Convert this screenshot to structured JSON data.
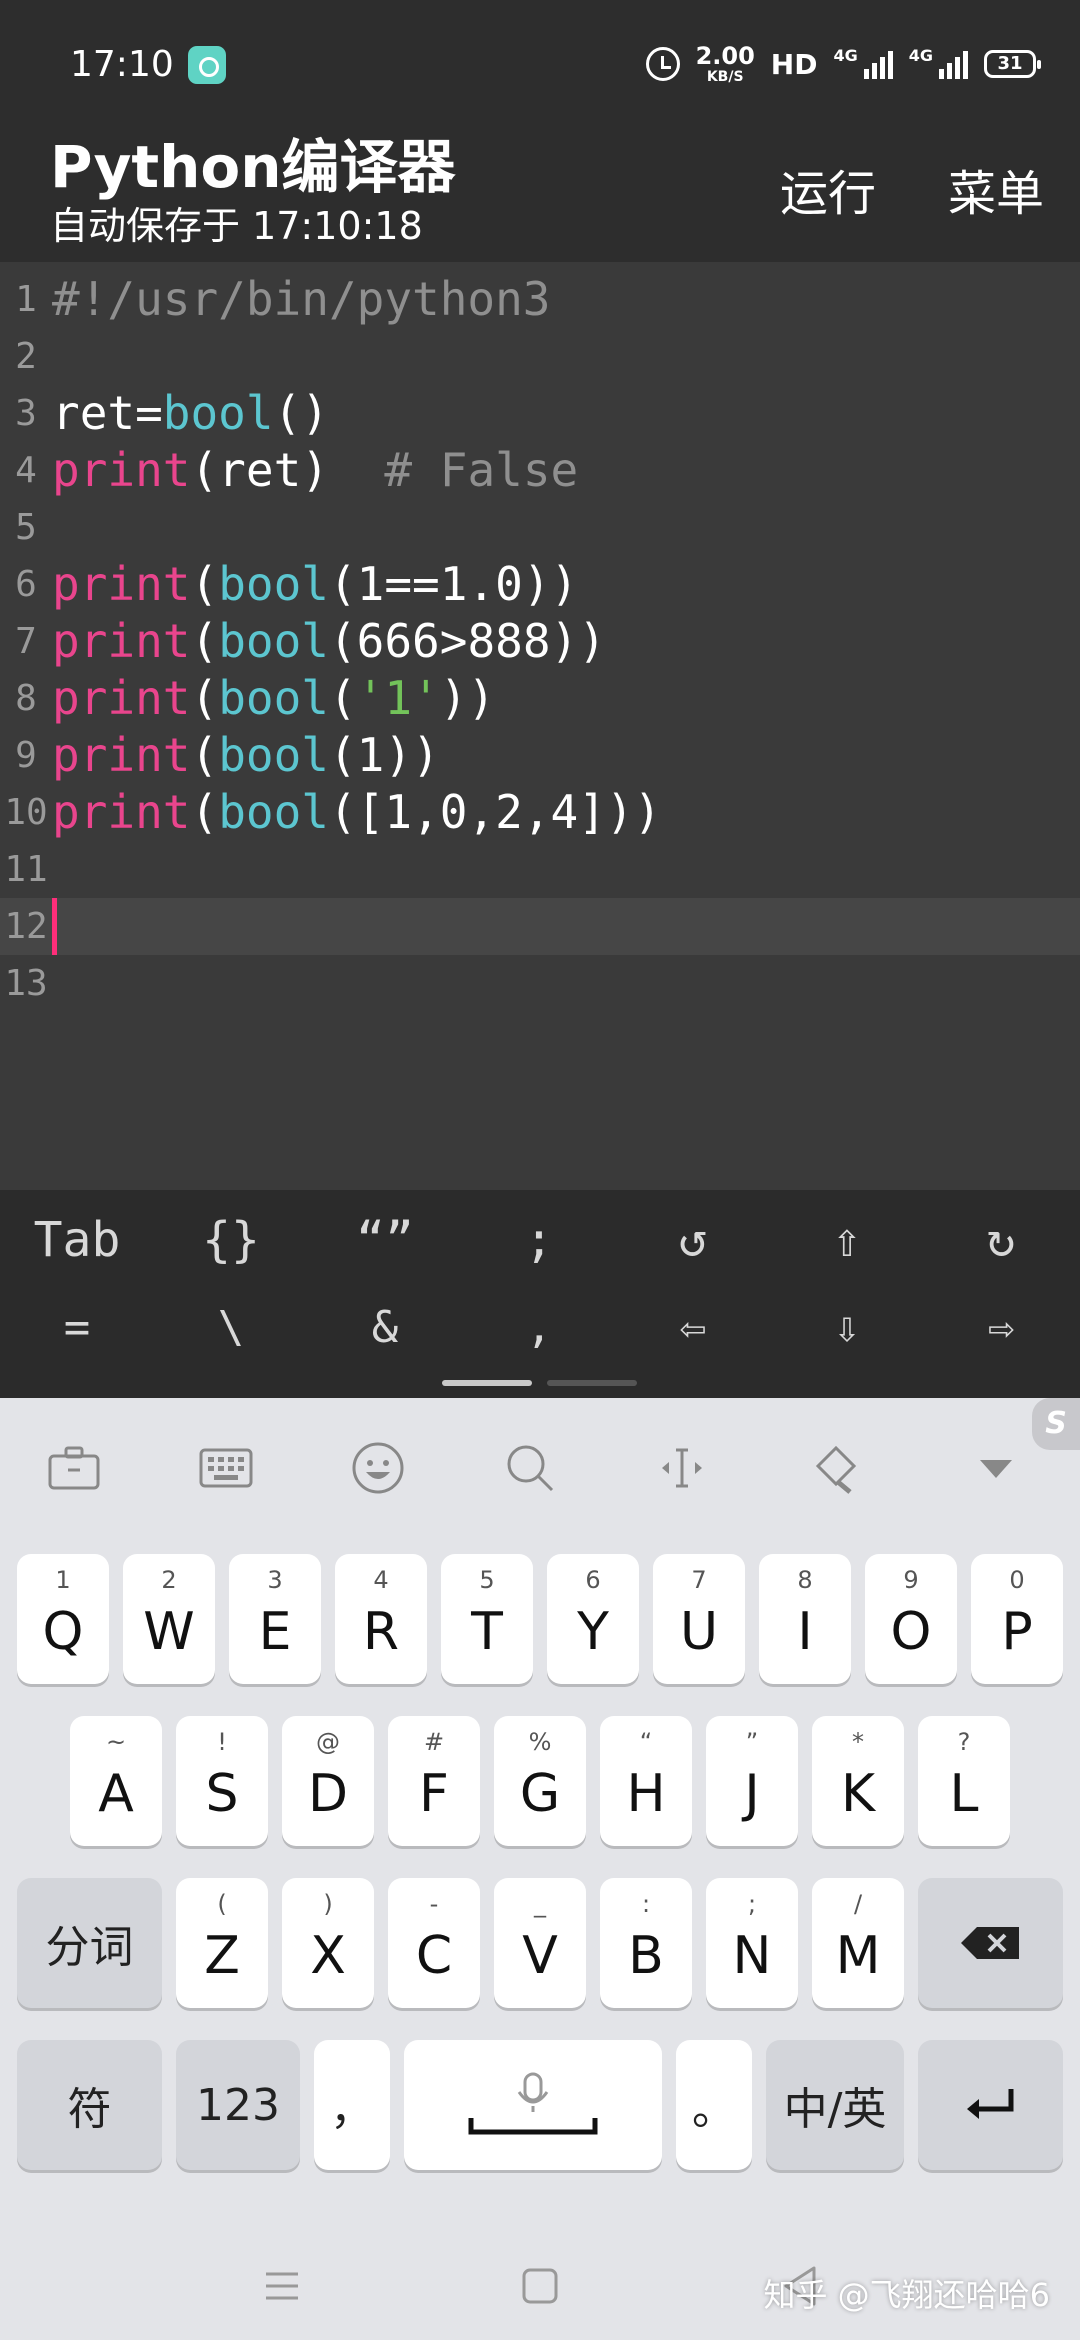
{
  "status_bar": {
    "time": "17:10",
    "speed_value": "2.00",
    "speed_unit": "KB/S",
    "hd": "HD",
    "net1": "4G",
    "net2": "4G",
    "battery": "31",
    "icons": [
      "app-notification-icon",
      "alarm-icon",
      "signal-icon",
      "battery-icon"
    ]
  },
  "app_bar": {
    "title": "Python编译器",
    "subtitle": "自动保存于 17:10:18",
    "run_label": "运行",
    "menu_label": "菜单"
  },
  "editor": {
    "current_line": 12,
    "lines": [
      {
        "n": "1",
        "tokens": [
          {
            "t": "#!/usr/bin/python3",
            "c": "comment"
          }
        ]
      },
      {
        "n": "2",
        "tokens": []
      },
      {
        "n": "3",
        "tokens": [
          {
            "t": "ret=",
            "c": "default"
          },
          {
            "t": "bool",
            "c": "builtin"
          },
          {
            "t": "()",
            "c": "default"
          }
        ]
      },
      {
        "n": "4",
        "tokens": [
          {
            "t": "print",
            "c": "keyword"
          },
          {
            "t": "(ret)  ",
            "c": "default"
          },
          {
            "t": "# False",
            "c": "comment"
          }
        ]
      },
      {
        "n": "5",
        "tokens": []
      },
      {
        "n": "6",
        "tokens": [
          {
            "t": "print",
            "c": "keyword"
          },
          {
            "t": "(",
            "c": "default"
          },
          {
            "t": "bool",
            "c": "builtin"
          },
          {
            "t": "(1==1.0))",
            "c": "default"
          }
        ]
      },
      {
        "n": "7",
        "tokens": [
          {
            "t": "print",
            "c": "keyword"
          },
          {
            "t": "(",
            "c": "default"
          },
          {
            "t": "bool",
            "c": "builtin"
          },
          {
            "t": "(666>888))",
            "c": "default"
          }
        ]
      },
      {
        "n": "8",
        "tokens": [
          {
            "t": "print",
            "c": "keyword"
          },
          {
            "t": "(",
            "c": "default"
          },
          {
            "t": "bool",
            "c": "builtin"
          },
          {
            "t": "(",
            "c": "default"
          },
          {
            "t": "'1'",
            "c": "string"
          },
          {
            "t": "))",
            "c": "default"
          }
        ]
      },
      {
        "n": "9",
        "tokens": [
          {
            "t": "print",
            "c": "keyword"
          },
          {
            "t": "(",
            "c": "default"
          },
          {
            "t": "bool",
            "c": "builtin"
          },
          {
            "t": "(1))",
            "c": "default"
          }
        ]
      },
      {
        "n": "10",
        "tokens": [
          {
            "t": "print",
            "c": "keyword"
          },
          {
            "t": "(",
            "c": "default"
          },
          {
            "t": "bool",
            "c": "builtin"
          },
          {
            "t": "([1,0,2,4]))",
            "c": "default"
          }
        ]
      },
      {
        "n": "11",
        "tokens": []
      },
      {
        "n": "12",
        "tokens": []
      },
      {
        "n": "13",
        "tokens": []
      }
    ],
    "colors": {
      "comment": "#8f8f8f",
      "keyword": "#e9458d",
      "builtin": "#5cc6d0",
      "string": "#73c35a",
      "default": "#ffffff"
    }
  },
  "extra_keys": {
    "row1": [
      "Tab",
      "{}",
      "“”",
      ";",
      "↺",
      "⇧",
      "↻"
    ],
    "row2": [
      "=",
      "\\",
      "&",
      ",",
      "⇦",
      "⇩",
      "⇨"
    ]
  },
  "keyboard": {
    "toolbar": [
      "toolbox-icon",
      "keyboard-icon",
      "emoji-icon",
      "search-icon",
      "cursor-icon",
      "skin-brush-icon",
      "collapse-icon"
    ],
    "row1": [
      {
        "k": "Q",
        "h": "1"
      },
      {
        "k": "W",
        "h": "2"
      },
      {
        "k": "E",
        "h": "3"
      },
      {
        "k": "R",
        "h": "4"
      },
      {
        "k": "T",
        "h": "5"
      },
      {
        "k": "Y",
        "h": "6"
      },
      {
        "k": "U",
        "h": "7"
      },
      {
        "k": "I",
        "h": "8"
      },
      {
        "k": "O",
        "h": "9"
      },
      {
        "k": "P",
        "h": "0"
      }
    ],
    "row2": [
      {
        "k": "A",
        "h": "~"
      },
      {
        "k": "S",
        "h": "!"
      },
      {
        "k": "D",
        "h": "@"
      },
      {
        "k": "F",
        "h": "#"
      },
      {
        "k": "G",
        "h": "%"
      },
      {
        "k": "H",
        "h": "“"
      },
      {
        "k": "J",
        "h": "”"
      },
      {
        "k": "K",
        "h": "*"
      },
      {
        "k": "L",
        "h": "?"
      }
    ],
    "row3_left": "分词",
    "row3": [
      {
        "k": "Z",
        "h": "("
      },
      {
        "k": "X",
        "h": ")"
      },
      {
        "k": "C",
        "h": "-"
      },
      {
        "k": "V",
        "h": "_"
      },
      {
        "k": "B",
        "h": ":"
      },
      {
        "k": "N",
        "h": ";"
      },
      {
        "k": "M",
        "h": "/"
      }
    ],
    "row4": {
      "symbol": "符",
      "num": "123",
      "comma": "，",
      "period": "。",
      "lang": "中/英"
    }
  },
  "watermark": "知乎 @飞翔还哈哈6"
}
